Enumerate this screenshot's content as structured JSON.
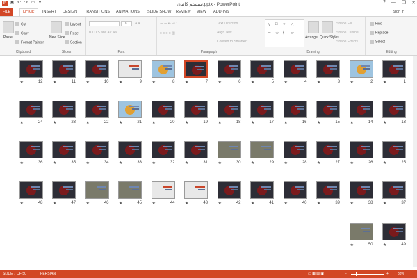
{
  "window": {
    "title": "سیستم کانبان.pptx - PowerPoint",
    "controls": [
      "?",
      "—",
      "❐",
      "✕"
    ],
    "sign_in": "Sign in"
  },
  "tabs": [
    "FILE",
    "HOME",
    "INSERT",
    "DESIGN",
    "TRANSITIONS",
    "ANIMATIONS",
    "SLIDE SHOW",
    "REVIEW",
    "VIEW",
    "ADD-INS"
  ],
  "active_tab": "HOME",
  "ribbon": {
    "clipboard": {
      "label": "Clipboard",
      "paste": "Paste",
      "cut": "Cut",
      "copy": "Copy",
      "format_painter": "Format Painter"
    },
    "slides": {
      "label": "Slides",
      "new_slide": "New Slide",
      "layout": "Layout",
      "reset": "Reset",
      "section": "Section"
    },
    "font": {
      "label": "Font",
      "size": "18"
    },
    "paragraph": {
      "label": "Paragraph",
      "text_direction": "Text Direction",
      "align_text": "Align Text",
      "convert": "Convert to SmartArt"
    },
    "drawing": {
      "label": "Drawing",
      "arrange": "Arrange",
      "quick_styles": "Quick Styles",
      "shape_fill": "Shape Fill",
      "shape_outline": "Shape Outline",
      "shape_effects": "Shape Effects"
    },
    "editing": {
      "label": "Editing",
      "find": "Find",
      "replace": "Replace",
      "select": "Select"
    }
  },
  "slides": [
    {
      "n": "1",
      "style": "dark"
    },
    {
      "n": "2",
      "style": "bright"
    },
    {
      "n": "3",
      "style": "dark"
    },
    {
      "n": "4",
      "style": "dark"
    },
    {
      "n": "5",
      "style": "dark"
    },
    {
      "n": "6",
      "style": "dark"
    },
    {
      "n": "7",
      "style": "dark",
      "selected": true
    },
    {
      "n": "8",
      "style": "bright"
    },
    {
      "n": "9",
      "style": "light"
    },
    {
      "n": "10",
      "style": "dark"
    },
    {
      "n": "11",
      "style": "dark"
    },
    {
      "n": "12",
      "style": "dark"
    },
    {
      "n": "13",
      "style": "dark"
    },
    {
      "n": "14",
      "style": "dark"
    },
    {
      "n": "15",
      "style": "dark"
    },
    {
      "n": "16",
      "style": "dark"
    },
    {
      "n": "17",
      "style": "dark"
    },
    {
      "n": "18",
      "style": "dark"
    },
    {
      "n": "19",
      "style": "dark"
    },
    {
      "n": "20",
      "style": "dark"
    },
    {
      "n": "21",
      "style": "bright"
    },
    {
      "n": "22",
      "style": "dark"
    },
    {
      "n": "23",
      "style": "dark"
    },
    {
      "n": "24",
      "style": "dark"
    },
    {
      "n": "25",
      "style": "dark"
    },
    {
      "n": "26",
      "style": "dark"
    },
    {
      "n": "27",
      "style": "dark"
    },
    {
      "n": "28",
      "style": "dark"
    },
    {
      "n": "29",
      "style": "photo"
    },
    {
      "n": "30",
      "style": "photo"
    },
    {
      "n": "31",
      "style": "dark"
    },
    {
      "n": "32",
      "style": "dark"
    },
    {
      "n": "33",
      "style": "dark"
    },
    {
      "n": "34",
      "style": "dark"
    },
    {
      "n": "35",
      "style": "dark"
    },
    {
      "n": "36",
      "style": "dark"
    },
    {
      "n": "37",
      "style": "dark"
    },
    {
      "n": "38",
      "style": "dark"
    },
    {
      "n": "39",
      "style": "dark"
    },
    {
      "n": "40",
      "style": "dark"
    },
    {
      "n": "41",
      "style": "dark"
    },
    {
      "n": "42",
      "style": "dark"
    },
    {
      "n": "43",
      "style": "light"
    },
    {
      "n": "44",
      "style": "light"
    },
    {
      "n": "45",
      "style": "photo"
    },
    {
      "n": "46",
      "style": "photo"
    },
    {
      "n": "47",
      "style": "dark"
    },
    {
      "n": "48",
      "style": "dark"
    },
    {
      "n": "49",
      "style": "dark"
    },
    {
      "n": "50",
      "style": "photo"
    }
  ],
  "status": {
    "slide": "SLIDE 7 OF 50",
    "language": "PERSIAN",
    "zoom": "38%",
    "zoom_fraction": 0.38
  }
}
